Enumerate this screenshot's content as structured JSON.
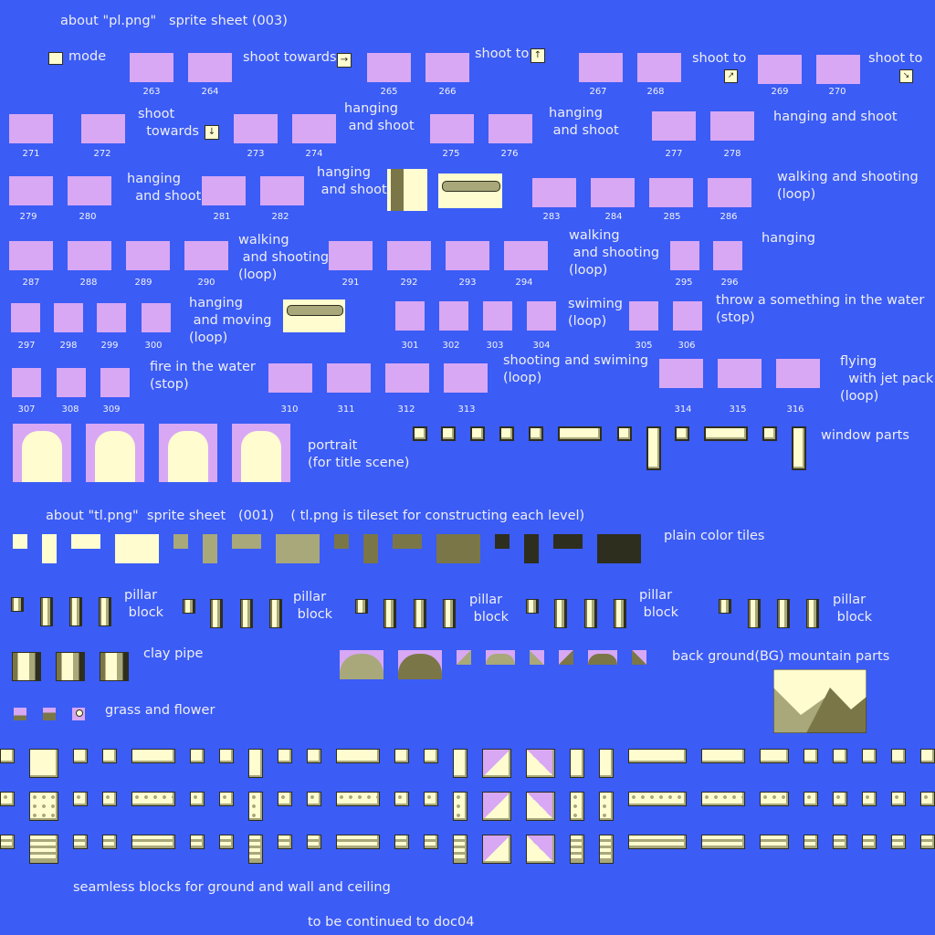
{
  "heading_pl": "about \"pl.png\"   sprite sheet (003)",
  "heading_tl": "about \"tl.png\"  sprite sheet   (001)    ( tl.png is tileset for constructing each level)",
  "labels": {
    "mode": "mode",
    "shoot_towards_right": "shoot towards",
    "shoot_to_up": "shoot to",
    "shoot_to_1": "shoot to",
    "shoot_to_2": "shoot to",
    "shoot_towards_down": "shoot\n  towards",
    "hanging_and_shoot_1": "hanging\n and shoot",
    "hanging_and_shoot_2": "hanging\n and shoot",
    "hanging_and_shoot_3": "hanging and shoot",
    "hanging_and_shoot_4": "hanging\n  and shoot",
    "hanging_and_shoot_5": "hanging\n and shoot",
    "walking_and_shooting_1": "walking and shooting\n(loop)",
    "walking_and_shooting_2": "walking\n and shooting\n(loop)",
    "walking_and_shooting_3": "walking\n and shooting\n(loop)",
    "hanging": "hanging",
    "hanging_and_moving": "hanging\n and moving\n(loop)",
    "swiming": "swiming\n(loop)",
    "throw": "throw a something in the water\n(stop)",
    "fire_in_water": "fire in the water\n(stop)",
    "shooting_swiming": "shooting and swiming\n(loop)",
    "flying": "flying\n  with jet pack\n(loop)",
    "window_parts": "window parts",
    "portrait": "portrait\n(for title scene)",
    "plain_color_tiles": "plain color tiles",
    "pillar_1": "pillar\n block",
    "pillar_2": "pillar\n block",
    "pillar_3": "pillar\n block",
    "pillar_4": "pillar\n block",
    "pillar_5": "pillar\n block",
    "clay_pipe": "clay pipe",
    "bg_mountain": "back ground(BG) mountain parts",
    "grass_flower": "grass and flower",
    "seamless": "seamless blocks for ground and wall and ceiling",
    "continued": "to be continued to doc04"
  },
  "frames_row1": [
    "263",
    "264",
    "265",
    "266",
    "267",
    "268",
    "269",
    "270"
  ],
  "frames_row2": [
    "271",
    "272",
    "273",
    "274",
    "275",
    "276",
    "277",
    "278"
  ],
  "frames_row3": [
    "279",
    "280",
    "281",
    "282",
    "283",
    "284",
    "285",
    "286"
  ],
  "frames_row4": [
    "287",
    "288",
    "289",
    "290",
    "291",
    "292",
    "293",
    "294",
    "295",
    "296"
  ],
  "frames_row5": [
    "297",
    "298",
    "299",
    "300",
    "301",
    "302",
    "303",
    "304",
    "305",
    "306"
  ],
  "frames_row6": [
    "307",
    "308",
    "309",
    "310",
    "311",
    "312",
    "313",
    "314",
    "315",
    "316"
  ],
  "colors": {
    "background": "#3b5cf5",
    "frame": "#d8a8f4",
    "cream": "#fffcd0",
    "olive": "#a8a87a",
    "olive_dark": "#7a7648",
    "dark": "#2e2e1e"
  }
}
